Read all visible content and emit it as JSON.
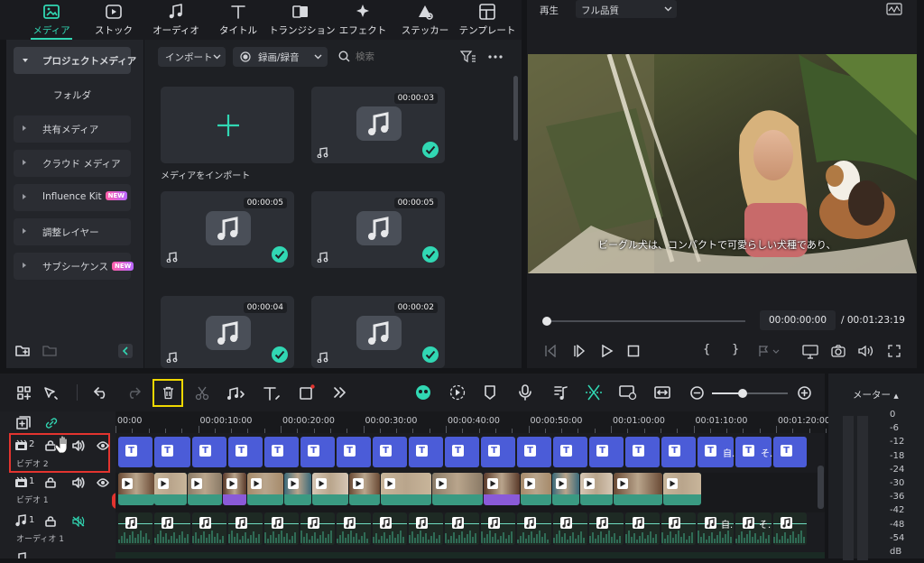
{
  "top_tabs": [
    {
      "label": "メディア",
      "icon": "media-icon",
      "active": true
    },
    {
      "label": "ストック",
      "icon": "stock-icon"
    },
    {
      "label": "オーディオ",
      "icon": "music-note-icon"
    },
    {
      "label": "タイトル",
      "icon": "title-t-icon"
    },
    {
      "label": "トランジション",
      "icon": "transition-icon"
    },
    {
      "label": "エフェクト",
      "icon": "effect-sparkle-icon"
    },
    {
      "label": "ステッカー",
      "icon": "sticker-icon"
    },
    {
      "label": "テンプレート",
      "icon": "template-icon"
    }
  ],
  "sidebar": {
    "items": [
      {
        "label": "プロジェクトメディア",
        "active": true
      },
      {
        "label": "フォルダ"
      },
      {
        "label": "共有メディア"
      },
      {
        "label": "クラウド メディア"
      },
      {
        "label": "Influence Kit",
        "badge": "NEW"
      },
      {
        "label": "調整レイヤー"
      },
      {
        "label": "サブシーケンス",
        "badge": "NEW"
      }
    ]
  },
  "media_toolbar": {
    "import_label": "インポート",
    "record_label": "録画/録音",
    "search_placeholder": "検索"
  },
  "media": {
    "import_card_label": "メディアをインポート",
    "items": [
      {
        "duration": "00:00:03",
        "checked": true
      },
      {
        "duration": "00:00:05",
        "checked": true
      },
      {
        "duration": "00:00:05",
        "checked": true
      },
      {
        "duration": "00:00:04",
        "checked": true
      },
      {
        "duration": "00:00:02",
        "checked": true
      }
    ]
  },
  "preview": {
    "play_label": "再生",
    "quality_label": "フル品質",
    "subtitle": "ビーグル犬は、コンパクトで可愛らしい犬種であり、",
    "current_time": "00:00:00:00",
    "total_time": "/ 00:01:23:19",
    "progress": 0.0
  },
  "timeline": {
    "ruler": [
      "00:00",
      "00:00:10:00",
      "00:00:20:00",
      "00:00:30:00",
      "00:00:40:00",
      "00:00:50:00",
      "00:01:00:00",
      "00:01:10:00",
      "00:01:20:00"
    ],
    "tracks": [
      {
        "number": "2",
        "label": "ビデオ 2"
      },
      {
        "number": "1",
        "label": "ビデオ 1"
      },
      {
        "number": "1",
        "label": "オーディオ 1"
      }
    ],
    "title_clip_texts": [
      "自...",
      "そ..."
    ],
    "audio_clip_texts": [
      "自...",
      "そ..."
    ]
  },
  "meter": {
    "label": "メーター",
    "scale": [
      "0",
      "-6",
      "-12",
      "-18",
      "-24",
      "-30",
      "-36",
      "-42",
      "-48",
      "-54",
      "dB"
    ]
  },
  "colors": {
    "accent": "#31d7b3",
    "title_clip": "#4b5cd8",
    "highlight": "#f0d800",
    "selection": "#e3342f"
  }
}
